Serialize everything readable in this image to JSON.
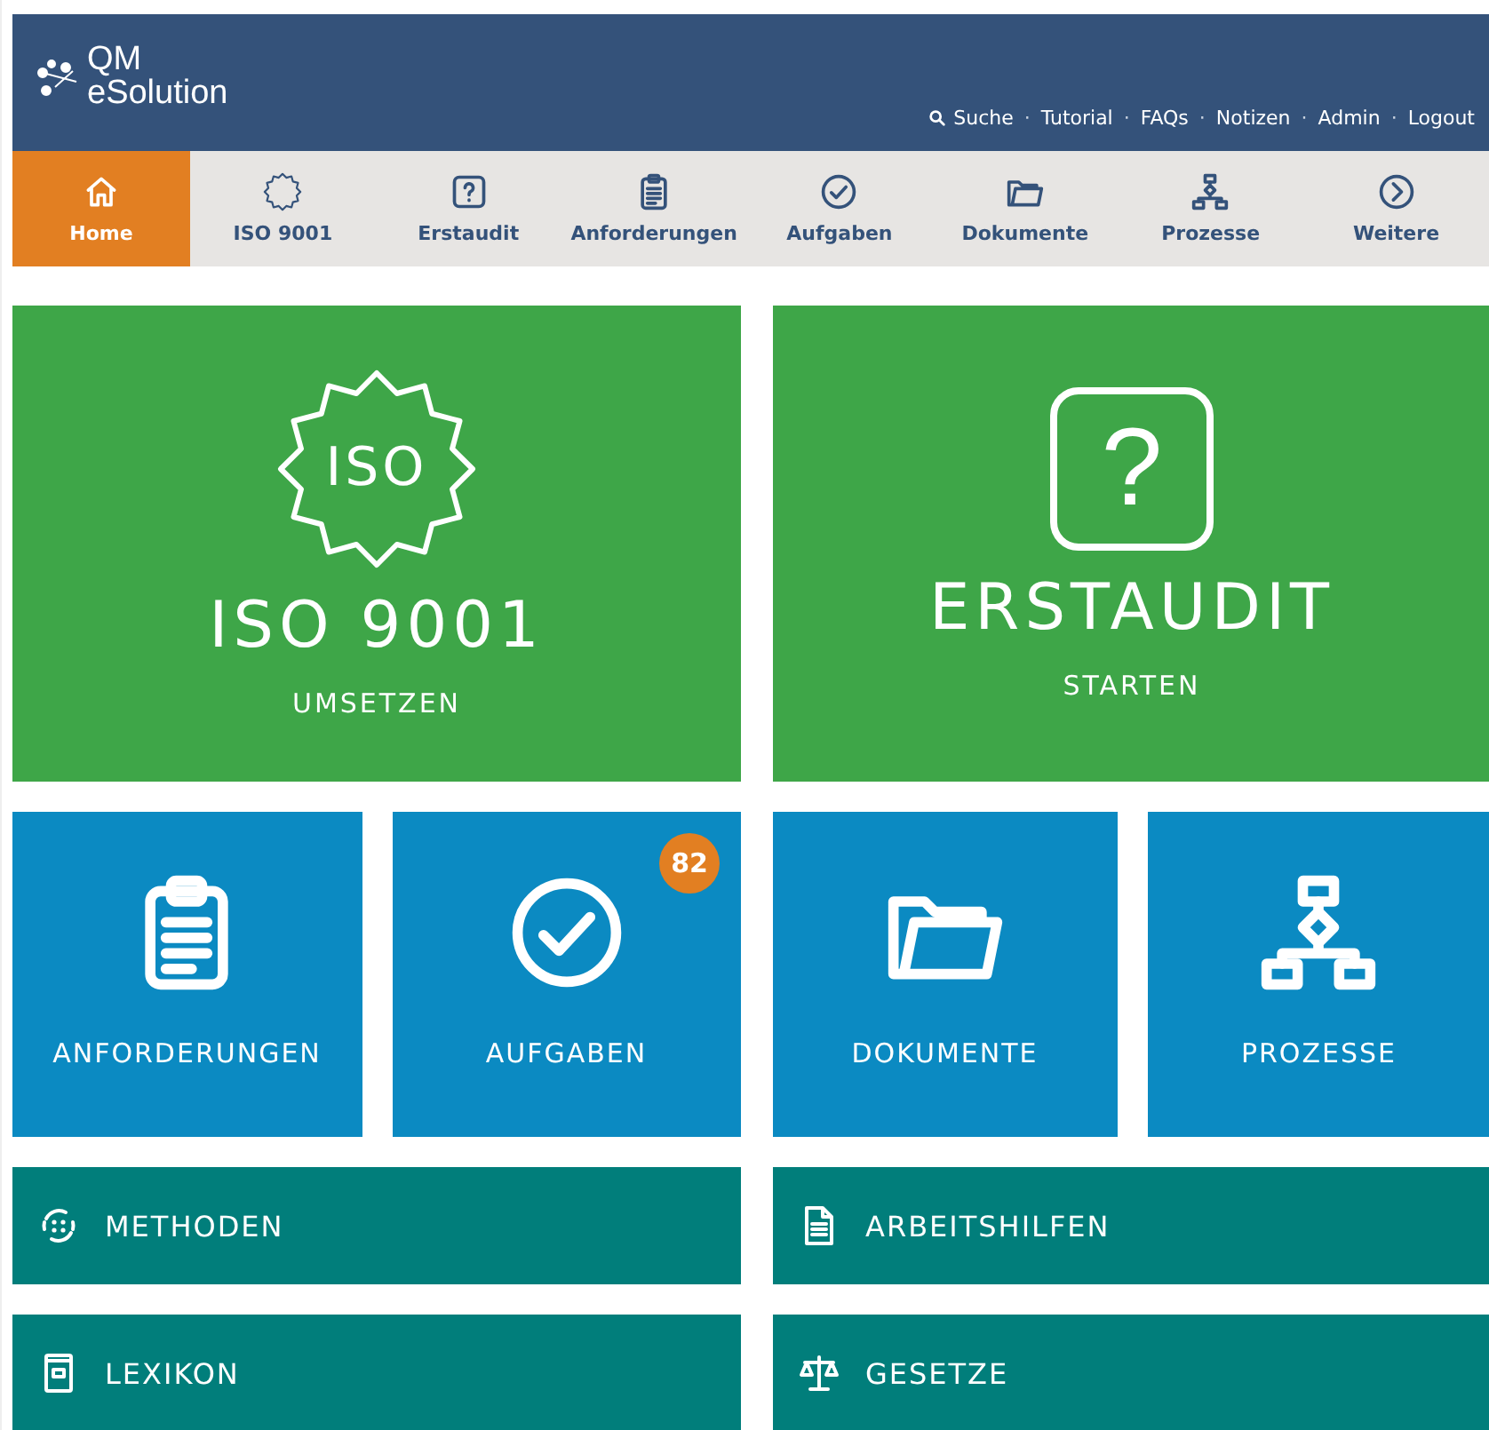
{
  "logo": {
    "line1": "QM",
    "line2": "eSolution"
  },
  "top_links": {
    "separator": "·",
    "items": [
      {
        "label": "Suche",
        "kind": "search"
      },
      {
        "label": "Tutorial",
        "kind": "plain"
      },
      {
        "label": "FAQs",
        "kind": "plain"
      },
      {
        "label": "Notizen",
        "kind": "plain"
      },
      {
        "label": "Admin",
        "kind": "plain"
      },
      {
        "label": "Logout",
        "kind": "plain"
      }
    ]
  },
  "nav": [
    {
      "label": "Home",
      "kind": "home",
      "selected": true
    },
    {
      "label": "ISO 9001",
      "kind": "iso",
      "selected": false
    },
    {
      "label": "Erstaudit",
      "kind": "question",
      "selected": false
    },
    {
      "label": "Anforderungen",
      "kind": "clipboard",
      "selected": false
    },
    {
      "label": "Aufgaben",
      "kind": "check",
      "selected": false
    },
    {
      "label": "Dokumente",
      "kind": "folder",
      "selected": false
    },
    {
      "label": "Prozesse",
      "kind": "process",
      "selected": false
    },
    {
      "label": "Weitere",
      "kind": "chevron",
      "selected": false
    }
  ],
  "hero_tiles": [
    {
      "title": "ISO 9001",
      "subtitle": "UMSETZEN",
      "kind": "iso",
      "label": "ISO"
    },
    {
      "title": "ERSTAUDIT",
      "subtitle": "STARTEN",
      "kind": "question",
      "label": "?"
    }
  ],
  "module_tiles": [
    {
      "title": "ANFORDERUNGEN",
      "kind": "clipboard"
    },
    {
      "title": "AUFGABEN",
      "kind": "check",
      "badge": "82"
    },
    {
      "title": "DOKUMENTE",
      "kind": "folder"
    },
    {
      "title": "PROZESSE",
      "kind": "process"
    }
  ],
  "link_rows": [
    {
      "title": "METHODEN",
      "kind": "cycle"
    },
    {
      "title": "ARBEITSHILFEN",
      "kind": "document"
    },
    {
      "title": "LEXIKON",
      "kind": "book"
    },
    {
      "title": "GESETZE",
      "kind": "scale"
    }
  ]
}
